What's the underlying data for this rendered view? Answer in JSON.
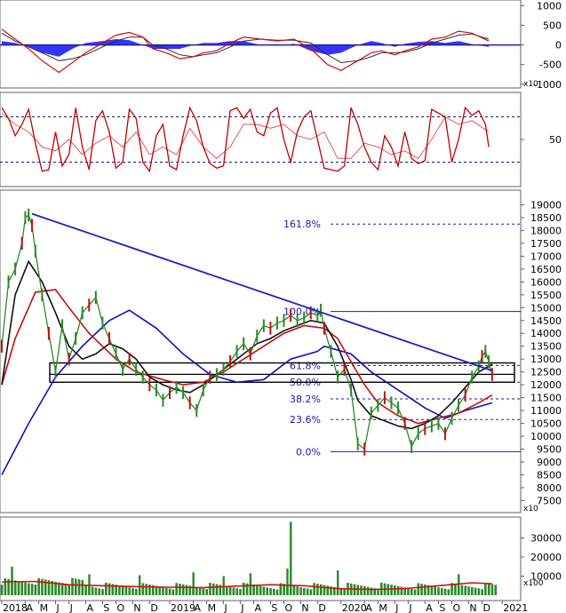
{
  "chart_data": [
    {
      "type": "area",
      "panel": "macd",
      "y_ticks": [
        "1000",
        "500",
        "0",
        "-500",
        "-1000"
      ],
      "y_tick_values": [
        1000,
        500,
        0,
        -500,
        -1000
      ],
      "ylim": [
        -1050,
        1100
      ],
      "y_multiplier": "x10",
      "series": [
        {
          "color": "#d01010",
          "x": [
            0,
            4,
            8,
            12,
            17,
            21,
            25,
            30,
            34,
            38,
            42,
            45,
            49,
            53,
            57,
            60,
            64,
            68,
            72,
            77,
            82,
            87,
            92,
            97,
            101,
            106,
            110,
            113,
            117,
            120,
            124,
            128,
            132,
            136,
            140,
            145
          ],
          "values": [
            400,
            150,
            -100,
            -400,
            -700,
            -450,
            -200,
            50,
            250,
            320,
            200,
            -100,
            -200,
            -350,
            -300,
            -200,
            -150,
            50,
            200,
            150,
            100,
            150,
            -100,
            -500,
            -650,
            -400,
            -200,
            -150,
            -250,
            -150,
            -50,
            150,
            200,
            350,
            300,
            100
          ]
        },
        {
          "color": "#303030",
          "x": [
            0,
            4,
            8,
            12,
            17,
            21,
            25,
            30,
            34,
            38,
            42,
            45,
            49,
            53,
            57,
            60,
            64,
            68,
            72,
            77,
            82,
            87,
            92,
            97,
            101,
            106,
            110,
            113,
            117,
            120,
            124,
            128,
            132,
            136,
            140,
            145
          ],
          "values": [
            300,
            100,
            -50,
            -200,
            -400,
            -350,
            -250,
            -50,
            100,
            200,
            200,
            0,
            -100,
            -250,
            -300,
            -250,
            -200,
            -50,
            100,
            150,
            120,
            120,
            50,
            -250,
            -450,
            -400,
            -300,
            -200,
            -200,
            -180,
            -100,
            50,
            150,
            250,
            280,
            150
          ]
        },
        {
          "color": "#1010ff",
          "x": [
            0,
            4,
            8,
            12,
            17,
            21,
            25,
            30,
            34,
            38,
            42,
            45,
            49,
            53,
            57,
            60,
            64,
            68,
            72,
            77,
            82,
            87,
            92,
            97,
            101,
            106,
            110,
            113,
            117,
            120,
            124,
            128,
            132,
            136,
            140,
            145
          ],
          "values": [
            100,
            50,
            -50,
            -200,
            -300,
            -100,
            50,
            100,
            150,
            120,
            0,
            -100,
            -100,
            -100,
            0,
            50,
            50,
            100,
            100,
            0,
            -20,
            30,
            -150,
            -250,
            -200,
            0,
            100,
            50,
            -50,
            30,
            80,
            100,
            50,
            100,
            20,
            -50
          ]
        }
      ]
    },
    {
      "type": "line",
      "panel": "stochastic",
      "y_ticks": [
        "50"
      ],
      "y_tick_values": [
        50
      ],
      "ylim": [
        -10,
        110
      ],
      "reference_lines": [
        80,
        20
      ],
      "series": [
        {
          "color": "#c00000",
          "x": [
            0,
            2,
            4,
            6,
            8,
            10,
            12,
            14,
            16,
            18,
            20,
            22,
            24,
            26,
            28,
            30,
            32,
            34,
            36,
            38,
            40,
            42,
            44,
            46,
            48,
            50,
            52,
            54,
            56,
            58,
            60,
            62,
            64,
            66,
            68,
            70,
            72,
            74,
            76,
            78,
            80,
            82,
            84,
            86,
            88,
            90,
            92,
            94,
            96,
            98,
            100,
            102,
            104,
            106,
            108,
            110,
            112,
            114,
            116,
            118,
            120,
            122,
            124,
            126,
            128,
            130,
            132,
            134,
            136,
            138,
            140,
            142,
            144,
            145
          ],
          "values": [
            92,
            78,
            55,
            70,
            90,
            45,
            8,
            10,
            60,
            15,
            30,
            92,
            40,
            10,
            75,
            88,
            60,
            12,
            20,
            90,
            78,
            20,
            8,
            55,
            70,
            15,
            10,
            55,
            92,
            75,
            40,
            18,
            12,
            15,
            88,
            92,
            78,
            90,
            60,
            55,
            85,
            92,
            50,
            20,
            60,
            80,
            88,
            50,
            12,
            10,
            8,
            15,
            92,
            70,
            40,
            20,
            10,
            55,
            40,
            15,
            60,
            25,
            18,
            22,
            90,
            85,
            80,
            20,
            50,
            92,
            82,
            88,
            70,
            40
          ]
        },
        {
          "color": "#d01010",
          "x": [
            0,
            4,
            8,
            12,
            16,
            20,
            24,
            28,
            32,
            36,
            40,
            44,
            48,
            52,
            56,
            60,
            64,
            68,
            72,
            76,
            80,
            84,
            88,
            92,
            96,
            100,
            104,
            108,
            112,
            116,
            120,
            124,
            128,
            132,
            136,
            140,
            145
          ],
          "values": [
            85,
            70,
            60,
            40,
            35,
            50,
            30,
            45,
            55,
            40,
            60,
            30,
            40,
            30,
            65,
            40,
            25,
            40,
            70,
            70,
            65,
            70,
            55,
            50,
            60,
            25,
            25,
            45,
            40,
            30,
            35,
            25,
            50,
            80,
            70,
            75,
            60
          ]
        }
      ]
    },
    {
      "type": "line",
      "panel": "price",
      "y_ticks": [
        "19000",
        "18500",
        "18000",
        "17500",
        "17000",
        "16500",
        "16000",
        "15500",
        "15000",
        "14500",
        "14000",
        "13500",
        "13000",
        "12500",
        "12000",
        "11500",
        "11000",
        "10500",
        "10000",
        "9500",
        "9000",
        "8500",
        "8000",
        "7500"
      ],
      "y_tick_values": [
        19000,
        18500,
        18000,
        17500,
        17000,
        16500,
        16000,
        15500,
        15000,
        14500,
        14000,
        13500,
        13000,
        12500,
        12000,
        11500,
        11000,
        10500,
        10000,
        9500,
        9000,
        8500,
        8000,
        7500
      ],
      "ylim": [
        7100,
        19500
      ],
      "y_multiplier": "x10",
      "fibonacci": {
        "levels": [
          {
            "label": "161.8%",
            "price": 18250
          },
          {
            "label": "100.0%",
            "price": 14850
          },
          {
            "label": "61.8%",
            "price": 12750
          },
          {
            "label": "50.0%",
            "price": 12100
          },
          {
            "label": "38.2%",
            "price": 11450
          },
          {
            "label": "23.6%",
            "price": 10650
          },
          {
            "label": "0.0%",
            "price": 9400
          }
        ]
      },
      "trendline": {
        "color": "#2020c0",
        "x": [
          9,
          146
        ],
        "values": [
          18650,
          12550
        ]
      },
      "zone": {
        "price_from": 12100,
        "price_to": 12850
      },
      "series": [
        {
          "color": "#1010c0",
          "x": [
            0,
            8,
            16,
            24,
            32,
            38,
            46,
            54,
            62,
            70,
            78,
            86,
            94,
            96,
            104,
            110,
            118,
            126,
            132,
            138,
            146
          ],
          "values": [
            8500,
            10500,
            12300,
            13500,
            14500,
            14900,
            14200,
            13200,
            12400,
            12100,
            12200,
            13000,
            13300,
            13500,
            13200,
            12500,
            11800,
            11100,
            10700,
            11000,
            11300
          ]
        },
        {
          "color": "#c01010",
          "x": [
            0,
            4,
            10,
            16,
            20,
            26,
            34,
            40,
            48,
            54,
            60,
            66,
            72,
            78,
            84,
            90,
            96,
            100,
            104,
            108,
            112,
            118,
            124,
            130,
            136,
            142,
            146
          ],
          "values": [
            12000,
            13800,
            15600,
            15700,
            15000,
            14000,
            13000,
            12500,
            12200,
            12000,
            12100,
            12500,
            13000,
            13500,
            14000,
            14300,
            14200,
            13800,
            12900,
            12000,
            11300,
            10800,
            10500,
            10700,
            10900,
            11300,
            11600
          ]
        },
        {
          "color": "#101010",
          "x": [
            0,
            4,
            8,
            12,
            16,
            20,
            24,
            28,
            32,
            36,
            40,
            44,
            48,
            52,
            56,
            60,
            64,
            68,
            72,
            76,
            80,
            84,
            88,
            92,
            96,
            100,
            104,
            106,
            110,
            114,
            118,
            122,
            126,
            130,
            134,
            138,
            142,
            146
          ],
          "values": [
            12000,
            15500,
            16800,
            16000,
            14800,
            13500,
            13000,
            13200,
            13600,
            13400,
            13000,
            12300,
            12000,
            11800,
            11700,
            12000,
            12400,
            12800,
            13200,
            13600,
            13800,
            14100,
            14300,
            14500,
            14400,
            13500,
            12200,
            11400,
            10800,
            10600,
            10400,
            10300,
            10500,
            10800,
            11300,
            11900,
            12500,
            12800
          ]
        },
        {
          "color": "#2a8a2a",
          "x": [
            0,
            2,
            4,
            6,
            7,
            8,
            9,
            10,
            12,
            14,
            16,
            18,
            20,
            22,
            24,
            26,
            28,
            30,
            32,
            34,
            36,
            38,
            40,
            42,
            44,
            46,
            48,
            50,
            52,
            54,
            56,
            58,
            60,
            62,
            64,
            66,
            68,
            70,
            72,
            74,
            76,
            78,
            80,
            82,
            84,
            86,
            88,
            90,
            92,
            94,
            95,
            96,
            98,
            100,
            102,
            104,
            106,
            108,
            110,
            112,
            114,
            116,
            118,
            120,
            122,
            124,
            126,
            128,
            130,
            132,
            134,
            136,
            138,
            140,
            142,
            143,
            144,
            145,
            146
          ],
          "values": [
            13500,
            16000,
            16500,
            17500,
            18500,
            18600,
            18200,
            17200,
            15500,
            14000,
            12500,
            14300,
            13000,
            13800,
            14800,
            15100,
            15400,
            14400,
            13800,
            13200,
            12600,
            13000,
            12600,
            12300,
            12000,
            11800,
            11400,
            11700,
            11900,
            11700,
            11300,
            11000,
            11800,
            12300,
            12400,
            12600,
            12900,
            13300,
            13600,
            13200,
            13900,
            14300,
            14200,
            14400,
            14500,
            14700,
            14500,
            14600,
            14800,
            14700,
            14900,
            14200,
            13300,
            12300,
            12600,
            11800,
            9700,
            9500,
            10900,
            11200,
            11500,
            11300,
            11100,
            10500,
            9600,
            10100,
            10300,
            10400,
            10500,
            10100,
            10700,
            11200,
            11600,
            12300,
            12700,
            13100,
            13300,
            12900,
            12400
          ]
        }
      ]
    },
    {
      "type": "bar",
      "panel": "volume",
      "y_ticks": [
        "30000",
        "20000",
        "10000"
      ],
      "y_tick_values": [
        30000,
        20000,
        10000
      ],
      "ylim": [
        0,
        40000
      ],
      "y_multiplier": "x100",
      "volume_ma": {
        "color": "#d01010",
        "x": [
          0,
          10,
          20,
          30,
          40,
          50,
          60,
          70,
          80,
          90,
          100,
          110,
          120,
          130,
          140,
          146
        ],
        "values": [
          7000,
          7200,
          5500,
          5000,
          4500,
          4200,
          4000,
          4800,
          5500,
          5000,
          3500,
          3000,
          3500,
          5000,
          6500,
          6000
        ]
      },
      "volume_spikes": [
        {
          "x": 86,
          "value": 38500
        },
        {
          "x": 85,
          "value": 14000
        },
        {
          "x": 3,
          "value": 15000
        },
        {
          "x": 26,
          "value": 11000
        },
        {
          "x": 41,
          "value": 10500
        },
        {
          "x": 57,
          "value": 12000
        },
        {
          "x": 66,
          "value": 10000
        },
        {
          "x": 74,
          "value": 11500
        },
        {
          "x": 100,
          "value": 13000
        },
        {
          "x": 136,
          "value": 11000
        }
      ],
      "x_ticks": [
        "2018",
        "A",
        "M",
        "J",
        "J",
        "A",
        "S",
        "O",
        "N",
        "D",
        "2019",
        "A",
        "M",
        "J",
        "J",
        "A",
        "S",
        "O",
        "N",
        "D",
        "2020",
        "A",
        "M",
        "J",
        "J",
        "A",
        "S",
        "O",
        "N",
        "D",
        "2021"
      ],
      "x_tick_positions": [
        0,
        7,
        11,
        16,
        20,
        25,
        30,
        34,
        39,
        44,
        50,
        57,
        61,
        66,
        71,
        75,
        80,
        84,
        89,
        94,
        101,
        108,
        112,
        117,
        121,
        126,
        130,
        134,
        139,
        143,
        149
      ]
    }
  ]
}
